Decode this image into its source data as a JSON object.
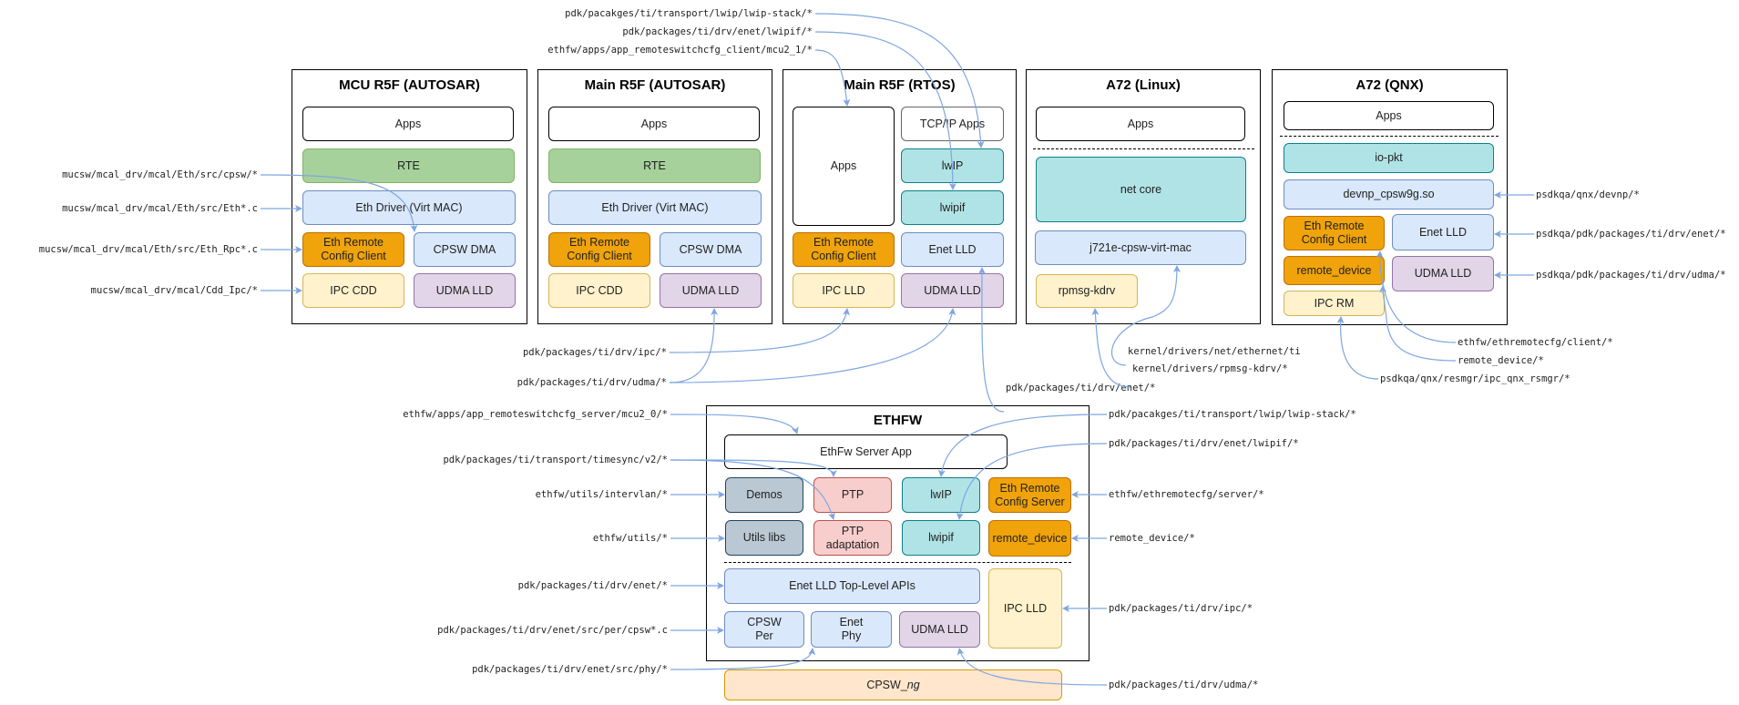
{
  "groups": {
    "mcu": {
      "title": "MCU R5F (AUTOSAR)",
      "apps": "Apps",
      "rte": "RTE",
      "eth_driver": "Eth Driver (Virt MAC)",
      "erc_client": "Eth Remote\nConfig Client",
      "cpsw_dma": "CPSW DMA",
      "ipc": "IPC CDD",
      "udma": "UDMA LLD"
    },
    "main_autosar": {
      "title": "Main R5F (AUTOSAR)",
      "apps": "Apps",
      "rte": "RTE",
      "eth_driver": "Eth Driver (Virt MAC)",
      "erc_client": "Eth Remote\nConfig Client",
      "cpsw_dma": "CPSW DMA",
      "ipc": "IPC CDD",
      "udma": "UDMA LLD"
    },
    "main_rtos": {
      "title": "Main R5F (RTOS)",
      "apps": "Apps",
      "tcpip_apps": "TCP/IP Apps",
      "lwip": "lwIP",
      "lwipif": "lwipif",
      "erc_client": "Eth Remote\nConfig Client",
      "enet_lld": "Enet LLD",
      "ipc": "IPC LLD",
      "udma": "UDMA LLD"
    },
    "a72_linux": {
      "title": "A72 (Linux)",
      "apps": "Apps",
      "net_core": "net core",
      "virt_mac": "j721e-cpsw-virt-mac",
      "rpmsg": "rpmsg-kdrv"
    },
    "a72_qnx": {
      "title": "A72 (QNX)",
      "apps": "Apps",
      "io_pkt": "io-pkt",
      "devnp": "devnp_cpsw9g.so",
      "erc_client": "Eth Remote\nConfig Client",
      "enet_lld": "Enet LLD",
      "remote_device": "remote_device",
      "udma": "UDMA LLD",
      "ipc_rm": "IPC RM"
    },
    "ethfw": {
      "title": "ETHFW",
      "server_app": "EthFw Server App",
      "demos": "Demos",
      "ptp": "PTP",
      "lwip": "lwIP",
      "erc_server": "Eth Remote\nConfig Server",
      "utils_libs": "Utils libs",
      "ptp_adaptation": "PTP\nadaptation",
      "lwipif": "lwipif",
      "remote_device": "remote_device",
      "enet_top": "Enet LLD Top-Level APIs",
      "ipc_lld": "IPC LLD",
      "cpsw_per": "CPSW\nPer",
      "enet_phy": "Enet\nPhy",
      "udma": "UDMA LLD"
    },
    "cpsw_ng": {
      "prefix": "CPSW_",
      "suffix": "ng"
    }
  },
  "labels": {
    "top_lwip_stack": "pdk/pacakges/ti/transport/lwip/lwip-stack/*",
    "top_lwipif": "pdk/packages/ti/drv/enet/lwipif/*",
    "top_client_app": "ethfw/apps/app_remoteswitchcfg_client/mcu2_1/*",
    "mcu_cpsw": "mucsw/mcal_drv/mcal/Eth/src/cpsw/*",
    "mcu_eth": "mucsw/mcal_drv/mcal/Eth/src/Eth*.c",
    "mcu_rpc": "mucsw/mcal_drv/mcal/Eth/src/Eth_Rpc*.c",
    "mcu_cdd_ipc": "mucsw/mcal_drv/mcal/Cdd_Ipc/*",
    "mid_ipc": "pdk/packages/ti/drv/ipc/*",
    "mid_udma": "pdk/packages/ti/drv/udma/*",
    "mid_enet": "pdk/packages/ti/drv/enet/*",
    "linux_net": "kernel/drivers/net/ethernet/ti",
    "linux_rpmsg": "kernel/drivers/rpmsg-kdrv/*",
    "qnx_devnp": "psdkqa/qnx/devnp/*",
    "qnx_enet": "psdkqa/pdk/packages/ti/drv/enet/*",
    "qnx_udma": "psdkqa/pdk/packages/ti/drv/udma/*",
    "qnx_client": "ethfw/ethremotecfg/client/*",
    "qnx_remote_device": "remote_device/*",
    "qnx_resmgr": "psdkqa/qnx/resmgr/ipc_qnx_rsmgr/*",
    "ethfw_server_app": "ethfw/apps/app_remoteswitchcfg_server/mcu2_0/*",
    "ethfw_timesync": "pdk/packages/ti/transport/timesync/v2/*",
    "ethfw_intervlan": "ethfw/utils/intervlan/*",
    "ethfw_utils": "ethfw/utils/*",
    "ethfw_enet": "pdk/packages/ti/drv/enet/*",
    "ethfw_cpsw_per": "pdk/packages/ti/drv/enet/src/per/cpsw*.c",
    "ethfw_phy": "pdk/packages/ti/drv/enet/src/phy/*",
    "ethfw_lwip_stack": "pdk/pacakges/ti/transport/lwip/lwip-stack/*",
    "ethfw_lwipif": "pdk/packages/ti/drv/enet/lwipif/*",
    "ethfw_remotecfg_server": "ethfw/ethremotecfg/server/*",
    "ethfw_remote_device": "remote_device/*",
    "ethfw_ipc": "pdk/packages/ti/drv/ipc/*",
    "ethfw_udma": "pdk/packages/ti/drv/udma/*"
  },
  "colors": {
    "arrow": "#7ea6e0"
  }
}
